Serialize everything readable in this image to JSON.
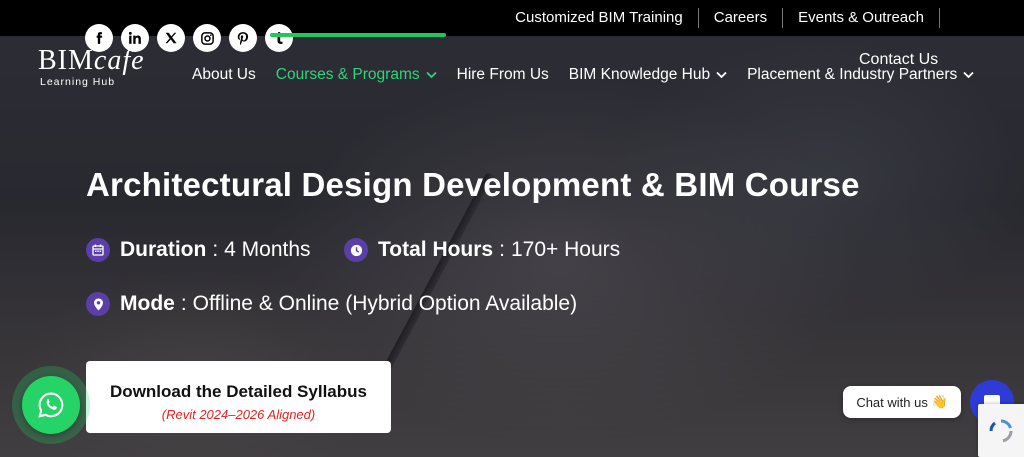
{
  "top_links": [
    "Customized BIM Training",
    "Careers",
    "Events & Outreach"
  ],
  "socials": [
    "facebook-icon",
    "linkedin-icon",
    "x-icon",
    "instagram-icon",
    "pinterest-icon",
    "tumblr-icon"
  ],
  "logo": {
    "main": "BIM",
    "script": "cafe",
    "sub": "Learning Hub"
  },
  "nav": {
    "contact": "Contact Us",
    "items": [
      {
        "label": "About Us",
        "dropdown": false
      },
      {
        "label": "Courses & Programs",
        "dropdown": true
      },
      {
        "label": "Hire From Us",
        "dropdown": false
      },
      {
        "label": "BIM Knowledge Hub",
        "dropdown": true
      },
      {
        "label": "Placement & Industry Partners",
        "dropdown": true
      }
    ]
  },
  "hero": {
    "title": "Architectural Design Development & BIM Course",
    "duration_label": "Duration",
    "duration_value": "4 Months",
    "hours_label": "Total Hours",
    "hours_value": "170+ Hours",
    "mode_label": "Mode",
    "mode_value": "Offline & Online (Hybrid Option Available)"
  },
  "download": {
    "label": "Download the Detailed Syllabus",
    "sub": "(Revit 2024–2026 Aligned)"
  },
  "chat": {
    "label": "Chat with us",
    "emoji": "👋"
  },
  "colors": {
    "accent_green": "#2ed47a",
    "icon_purple": "#5b3fa8",
    "whatsapp": "#25d366",
    "chat_blue": "#2f3bd6",
    "sub_red": "#e02424"
  }
}
